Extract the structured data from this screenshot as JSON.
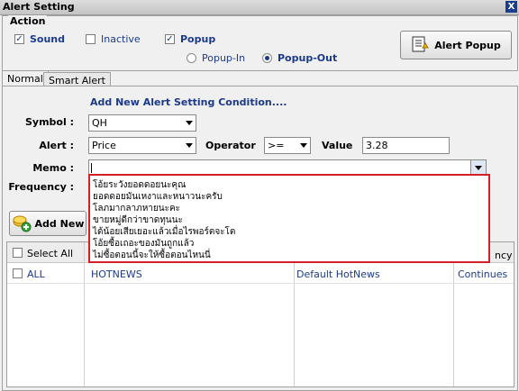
{
  "window": {
    "title": "Alert Setting",
    "close_label": "X"
  },
  "action": {
    "legend": "Action",
    "sound_label": "Sound",
    "sound_checked": true,
    "inactive_label": "Inactive",
    "inactive_checked": false,
    "popup_label": "Popup",
    "popup_checked": true,
    "popup_in_label": "Popup-In",
    "popup_out_label": "Popup-Out",
    "popup_selected": "Popup-Out",
    "alert_popup_button": "Alert Popup"
  },
  "tabs": [
    {
      "label": "Normal",
      "active": true
    },
    {
      "label": "Smart Alert",
      "active": false
    }
  ],
  "form": {
    "heading": "Add New Alert Setting Condition....",
    "symbol_label": "Symbol :",
    "symbol_value": "QH",
    "alert_label": "Alert :",
    "alert_value": "Price",
    "operator_label": "Operator",
    "operator_value": ">=",
    "value_label": "Value",
    "value_value": "3.28",
    "memo_label": "Memo :",
    "memo_value": "",
    "frequency_label": "Frequency :"
  },
  "memo_options": [
    "โอ้ยระวังยอดดอยนะคุณ",
    "ยอดดอยมันเหงาและหนาวนะครับ",
    "โลภมากลาภหายนะคะ",
    "ขายหมู่ดีกว่าขาดทุนนะ",
    "ได้น้อยเสียเยอะแล้วเมื่อไรพอร์ตจะโต",
    "โอ้ยซื้อเถอะของมันถูกแล้ว",
    "ไม่ซื้อตอนนี้จะให้ซื้อตอนไหนนี่"
  ],
  "add_new_button": "Add New",
  "table": {
    "select_all_label": "Select All",
    "header_fragment": "ncy",
    "rows": [
      {
        "symbol": "ALL",
        "name": "HOTNEWS",
        "memo": "Default HotNews",
        "frequency": "Continues"
      }
    ]
  },
  "colors": {
    "accent": "#1b3a8a",
    "highlight_border": "#d31f26"
  }
}
